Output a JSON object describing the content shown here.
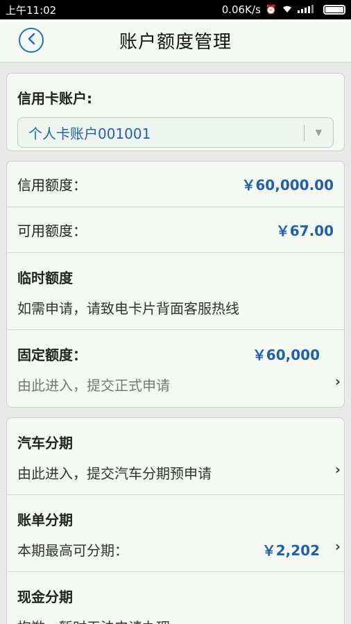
{
  "status": {
    "time": "上午11:02",
    "speed": "0.06K/s",
    "alarm_icon": "alarm-icon",
    "wifi_icon": "wifi-icon",
    "signal_icon": "signal-icon",
    "battery_icon": "battery-icon"
  },
  "header": {
    "title": "账户额度管理",
    "back_icon": "back-icon"
  },
  "account": {
    "label": "信用卡账户:",
    "selected": "个人卡账户001001"
  },
  "limits": {
    "credit_label": "信用额度：",
    "credit_value": "￥60,000.00",
    "available_label": "可用额度：",
    "available_value": "￥67.00",
    "temp_title": "临时额度",
    "temp_desc": "如需申请，请致电卡片背面客服热线",
    "fixed_title": "固定额度：",
    "fixed_value": "￥60,000",
    "fixed_desc": "由此进入，提交正式申请"
  },
  "installments": {
    "car_title": "汽车分期",
    "car_desc": "由此进入，提交汽车分期预申请",
    "bill_title": "账单分期",
    "bill_desc": "本期最高可分期：",
    "bill_value": "￥2,202",
    "cash_title": "现金分期",
    "cash_desc": "抱歉，暂时无法申请办理"
  },
  "colors": {
    "accent": "#1f5fab",
    "background": "#e9e9e9",
    "card": "#f5f9f3"
  }
}
